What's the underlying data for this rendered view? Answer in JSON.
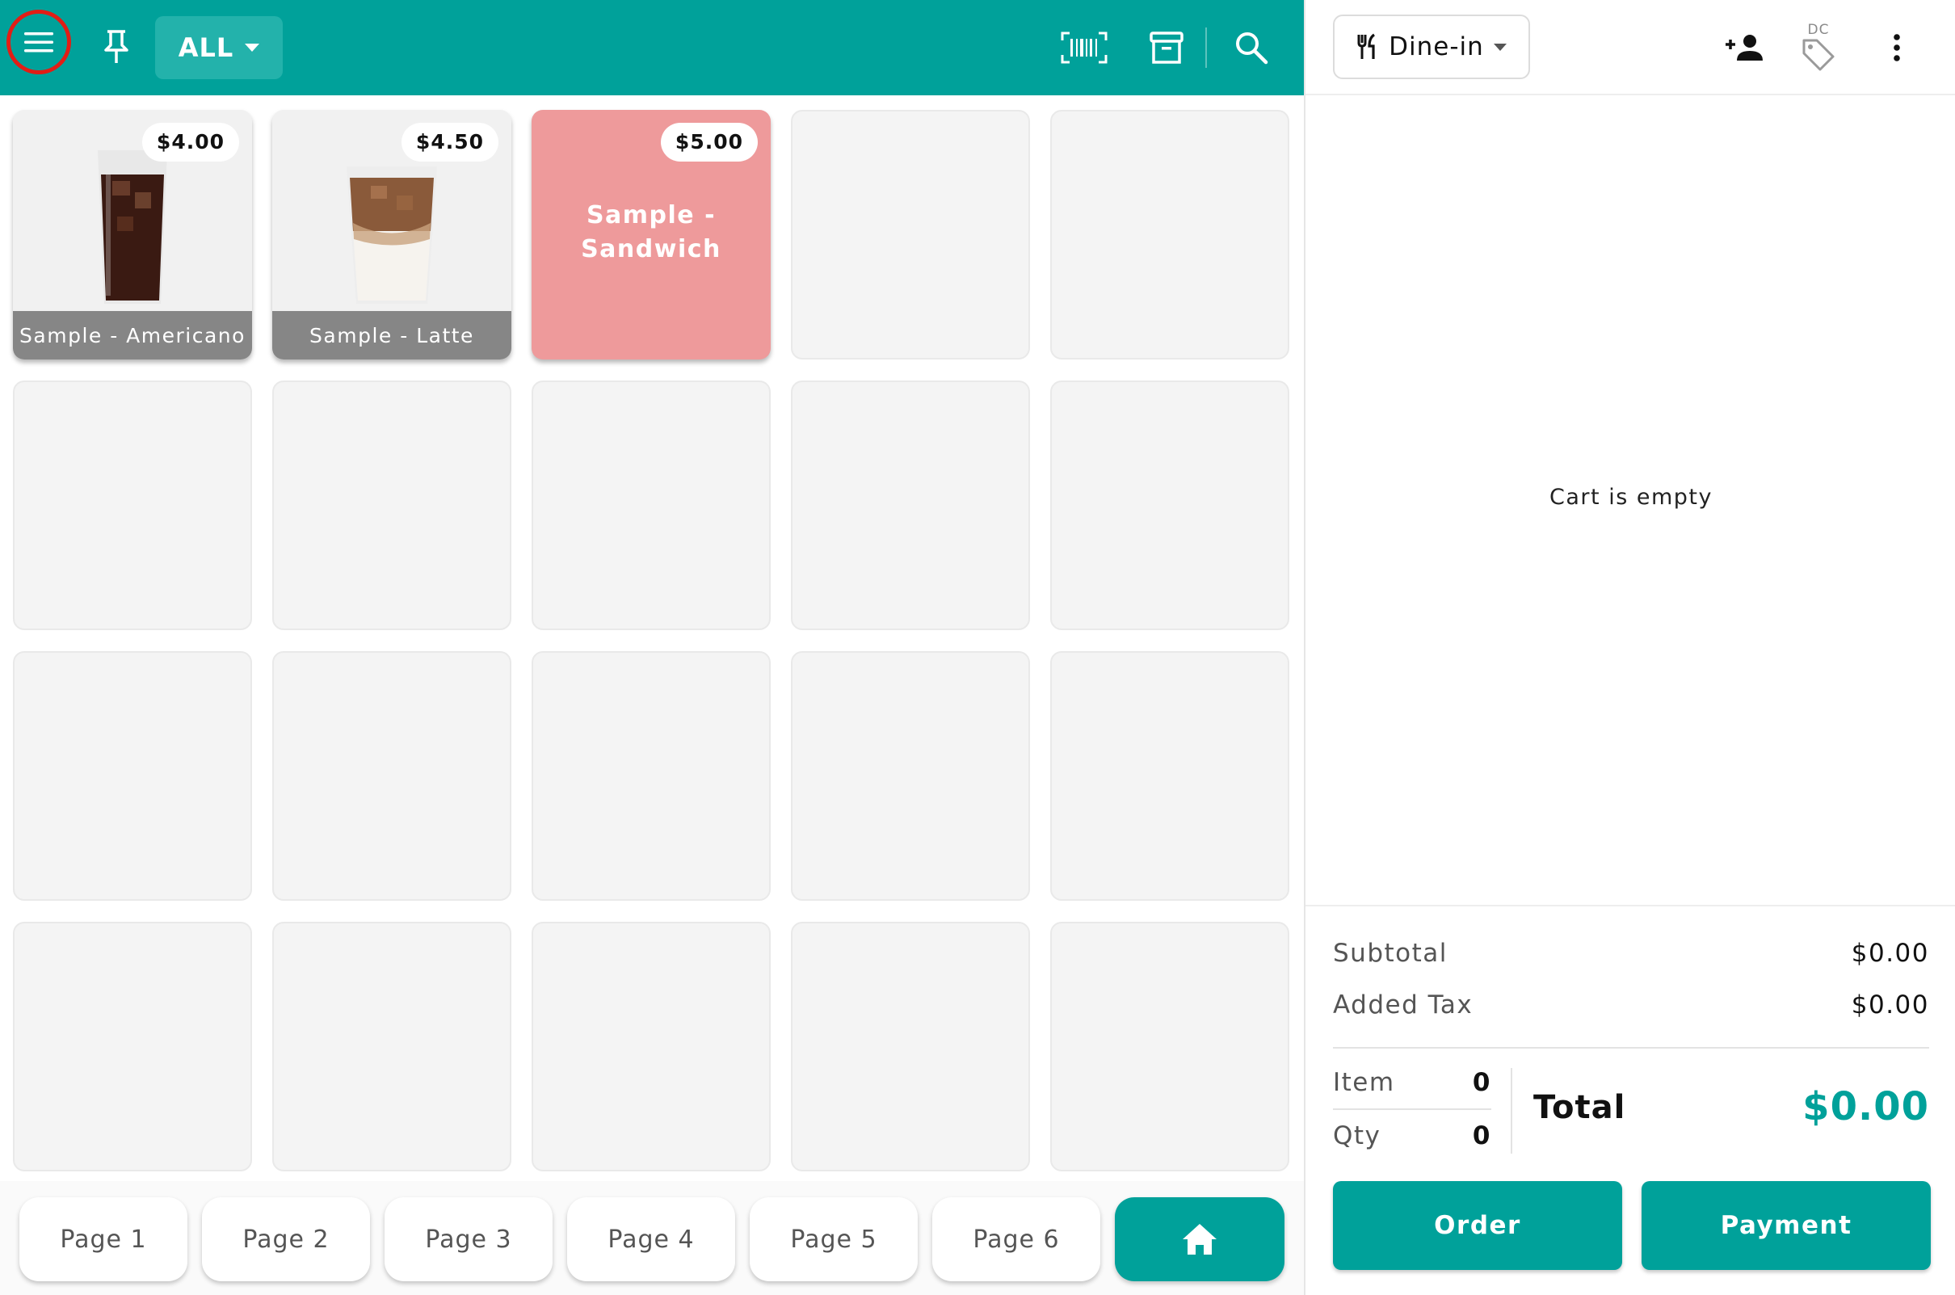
{
  "colors": {
    "accent": "#00a19a",
    "highlight_ring": "#e21d15",
    "sandwich_tile": "#ee9a9b"
  },
  "topbar": {
    "category_label": "ALL",
    "icons": [
      "menu-icon",
      "pin-icon",
      "barcode-icon",
      "archive-icon",
      "search-icon"
    ]
  },
  "products": [
    {
      "name": "Sample - Americano",
      "price": "$4.00"
    },
    {
      "name": "Sample - Latte",
      "price": "$4.50"
    },
    {
      "name": "Sample -\nSandwich",
      "price": "$5.00"
    }
  ],
  "pages": [
    "Page 1",
    "Page 2",
    "Page 3",
    "Page 4",
    "Page 5",
    "Page 6"
  ],
  "cart": {
    "order_type": "Dine-in",
    "dc_label": "DC",
    "empty_message": "Cart is empty",
    "subtotal_label": "Subtotal",
    "subtotal_value": "$0.00",
    "tax_label": "Added Tax",
    "tax_value": "$0.00",
    "item_label": "Item",
    "item_value": "0",
    "qty_label": "Qty",
    "qty_value": "0",
    "total_label": "Total",
    "total_value": "$0.00",
    "order_button": "Order",
    "payment_button": "Payment"
  }
}
